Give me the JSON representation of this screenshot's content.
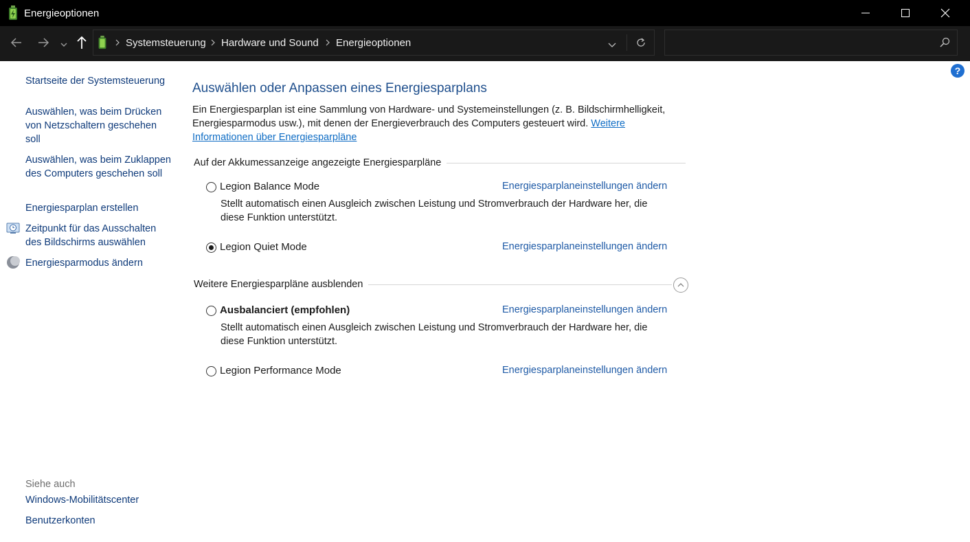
{
  "window": {
    "title": "Energieoptionen"
  },
  "navigation": {
    "breadcrumb": [
      "Systemsteuerung",
      "Hardware und Sound",
      "Energieoptionen"
    ],
    "search_placeholder": ""
  },
  "sidebar": {
    "links": [
      "Startseite der Systemsteuerung",
      "Auswählen, was beim Drücken von Netzschaltern geschehen soll",
      "Auswählen, was beim Zuklappen des Computers geschehen soll",
      "Energiesparplan erstellen",
      "Zeitpunkt für das Ausschalten des Bildschirms auswählen",
      "Energiesparmodus ändern"
    ],
    "see_also_label": "Siehe auch",
    "see_also_links": [
      "Windows-Mobilitätscenter",
      "Benutzerkonten"
    ]
  },
  "main": {
    "title": "Auswählen oder Anpassen eines Energiesparplans",
    "intro_text": "Ein Energiesparplan ist eine Sammlung von Hardware- und Systemeinstellungen (z. B. Bildschirmhelligkeit, Energiesparmodus usw.), mit denen der Energieverbrauch des Computers gesteuert wird. ",
    "intro_link": "Weitere Informationen über Energiesparpläne",
    "section_shown": "Auf der Akkumessanzeige angezeigte Energiesparpläne",
    "section_hidden": "Weitere Energiesparpläne ausblenden",
    "plans": [
      {
        "name": "Legion Balance Mode",
        "selected": false,
        "link": "Energiesparplaneinstellungen ändern",
        "description": "Stellt automatisch einen Ausgleich zwischen Leistung und Stromverbrauch der Hardware her, die diese Funktion unterstützt."
      },
      {
        "name": "Legion Quiet Mode",
        "selected": true,
        "link": "Energiesparplaneinstellungen ändern",
        "description": ""
      },
      {
        "name": "Ausbalanciert (empfohlen)",
        "selected": false,
        "link": "Energiesparplaneinstellungen ändern",
        "description": "Stellt automatisch einen Ausgleich zwischen Leistung und Stromverbrauch der Hardware her, die diese Funktion unterstützt."
      },
      {
        "name": "Legion Performance Mode",
        "selected": false,
        "link": "Energiesparplaneinstellungen ändern",
        "description": ""
      }
    ]
  },
  "colors": {
    "titlebar": "#000000",
    "navbar": "#191919",
    "heading": "#1e4e8c",
    "link": "#1e5aa6",
    "sidebar_link": "#0e3a7a",
    "help_badge": "#1f6fd1"
  }
}
